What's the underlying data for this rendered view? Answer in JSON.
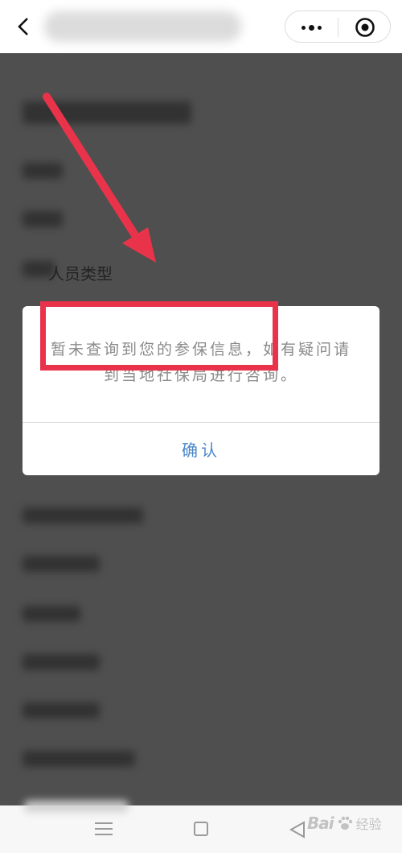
{
  "dialog": {
    "message": "暂未查询到您的参保信息，如有疑问请到当地社保局进行咨询。",
    "confirm_label": "确认"
  },
  "form": {
    "visible_label": "人员类型"
  },
  "watermark": {
    "text": "Bai",
    "sub": "经验"
  },
  "colors": {
    "annotation_red": "#e8334a",
    "confirm_blue": "#4a86c8",
    "overlay": "#3a3a3a",
    "dialog_text": "#8a8a8a"
  },
  "icons": {
    "back": "chevron-left-icon",
    "more": "more-dots-icon",
    "close": "target-close-icon",
    "nav_menu": "hamburger-icon",
    "nav_home": "square-home-icon",
    "nav_back": "triangle-back-icon"
  }
}
